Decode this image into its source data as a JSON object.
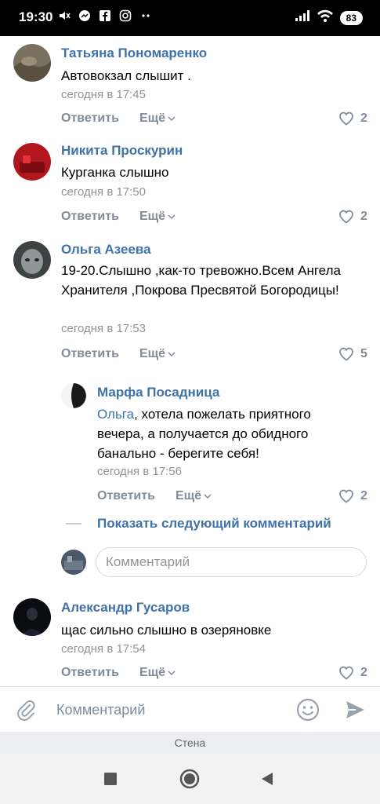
{
  "status": {
    "time": "19:30",
    "battery": "83",
    "left_icons": [
      "mute-icon",
      "messenger-icon",
      "facebook-icon",
      "instagram-icon",
      "more-dots-icon"
    ],
    "right_icons": [
      "signal-icon",
      "wifi-icon",
      "battery-icon"
    ]
  },
  "actions": {
    "reply_label": "Ответить",
    "more_label": "Ещё"
  },
  "comments": [
    {
      "author": "Татьяна Пономаренко",
      "text": "Автовокзал слышит .",
      "time": "сегодня в 17:45",
      "likes": "2"
    },
    {
      "author": "Никита Проскурин",
      "text": "Курганка слышно",
      "time": "сегодня в 17:50",
      "likes": "2"
    },
    {
      "author": "Ольга Азеева",
      "text": "19-20.Слышно ,как-то тревожно.Всем Ангела Хранителя ,Покрова Пресвятой Богородицы!",
      "time": "сегодня в 17:53",
      "likes": "5"
    },
    {
      "author": "Марфа Посадница",
      "mention": "Ольга",
      "text": ", хотела пожелать приятного вечера, а получается до обидного банально - берегите себя!",
      "time": "сегодня в 17:56",
      "likes": "2"
    },
    {
      "author": "Александр Гусаров",
      "text": "щас сильно слышно в озеряновке",
      "time": "сегодня в 17:54",
      "likes": "2"
    }
  ],
  "show_next_label": "Показать следующий комментарий",
  "reply_placeholder": "Комментарий",
  "bottom": {
    "placeholder": "Комментарий",
    "icons": [
      "attach-icon",
      "emoji-icon",
      "send-icon"
    ]
  },
  "footer_tab": "Стена",
  "navbar_icons": [
    "recent-apps-icon",
    "home-icon",
    "back-icon"
  ],
  "colors": {
    "link": "#3f72a8",
    "secondary": "#818c99",
    "time": "#939393"
  }
}
